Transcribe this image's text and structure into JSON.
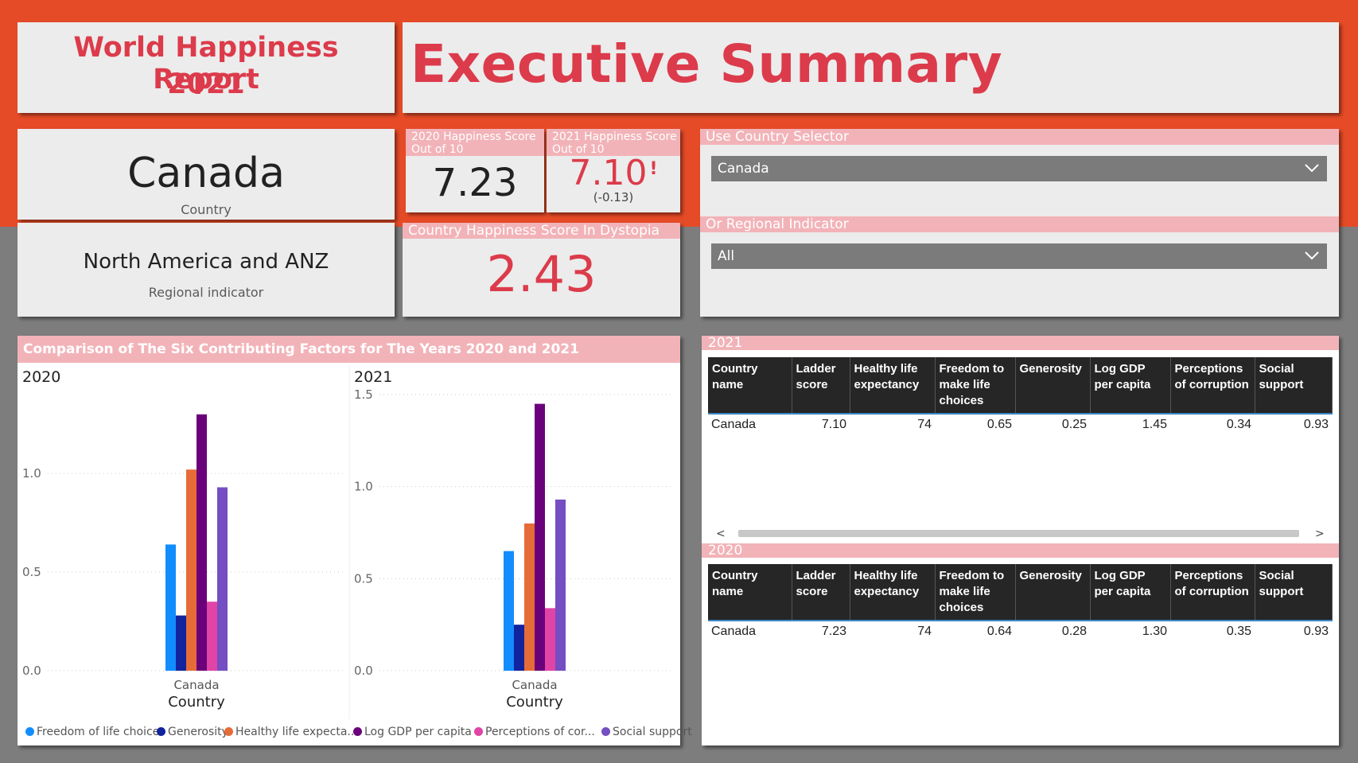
{
  "header": {
    "report_title_line1": "World Happiness Report",
    "report_title_line2": "2021",
    "page_title": "Executive Summary"
  },
  "country_card": {
    "value": "Canada",
    "label": "Country"
  },
  "region_card": {
    "value": "North America and ANZ",
    "label": "Regional indicator"
  },
  "kpi_2020": {
    "title": "2020 Happiness Score Out of 10",
    "value": "7.23"
  },
  "kpi_2021": {
    "title": "2021 Happiness Score Out of 10",
    "value": "7.10",
    "alert": "!",
    "delta": "(-0.13)"
  },
  "dystopia": {
    "title": "Country Happiness Score In Dystopia",
    "value": "2.43"
  },
  "selector": {
    "country_label": "Use Country Selector",
    "country_value": "Canada",
    "region_label": "Or Regional Indicator",
    "region_value": "All"
  },
  "colors": {
    "header_orange": "#e54b27",
    "title_red": "#dc3b4b",
    "pink_header": "#f2b3b8"
  },
  "chart": {
    "title": "Comparison of The Six Contributing Factors for The Years 2020 and 2021",
    "legend": [
      {
        "label": "Freedom of life choices",
        "color": "#118dff"
      },
      {
        "label": "Generosity",
        "color": "#12239e"
      },
      {
        "label": "Healthy life expecta...",
        "color": "#e66c37"
      },
      {
        "label": "Log GDP per capita",
        "color": "#6b007b"
      },
      {
        "label": "Perceptions of cor...",
        "color": "#e044a7"
      },
      {
        "label": "Social support",
        "color": "#744ec2"
      }
    ]
  },
  "chart_data": [
    {
      "type": "bar",
      "title": "2020",
      "xlabel": "Country",
      "categories": [
        "Canada"
      ],
      "ylim": [
        0,
        1.4
      ],
      "yticks": [
        "0.0",
        "0.5",
        "1.0"
      ],
      "grid": true,
      "legend_position": "bottom",
      "series": [
        {
          "name": "Freedom of life choices",
          "values": [
            0.64
          ]
        },
        {
          "name": "Generosity",
          "values": [
            0.28
          ]
        },
        {
          "name": "Healthy life expecta...",
          "values": [
            1.02
          ]
        },
        {
          "name": "Log GDP per capita",
          "values": [
            1.3
          ]
        },
        {
          "name": "Perceptions of cor...",
          "values": [
            0.35
          ]
        },
        {
          "name": "Social support",
          "values": [
            0.93
          ]
        }
      ]
    },
    {
      "type": "bar",
      "title": "2021",
      "xlabel": "Country",
      "categories": [
        "Canada"
      ],
      "ylim": [
        0,
        1.5
      ],
      "yticks": [
        "0.0",
        "0.5",
        "1.0",
        "1.5"
      ],
      "grid": true,
      "legend_position": "bottom",
      "series": [
        {
          "name": "Freedom of life choices",
          "values": [
            0.65
          ]
        },
        {
          "name": "Generosity",
          "values": [
            0.25
          ]
        },
        {
          "name": "Healthy life expecta...",
          "values": [
            0.8
          ]
        },
        {
          "name": "Log GDP per capita",
          "values": [
            1.45
          ]
        },
        {
          "name": "Perceptions of cor...",
          "values": [
            0.34
          ]
        },
        {
          "name": "Social support",
          "values": [
            0.93
          ]
        }
      ]
    }
  ],
  "tables": {
    "columns": [
      "Country name",
      "Ladder score",
      "Healthy life expectancy",
      "Freedom to make life choices",
      "Generosity",
      "Log GDP per capita",
      "Perceptions of corruption",
      "Social support"
    ],
    "t2021": {
      "title": "2021",
      "rows": [
        [
          "Canada",
          "7.10",
          "74",
          "0.65",
          "0.25",
          "1.45",
          "0.34",
          "0.93"
        ]
      ]
    },
    "t2020": {
      "title": "2020",
      "rows": [
        [
          "Canada",
          "7.23",
          "74",
          "0.64",
          "0.28",
          "1.30",
          "0.35",
          "0.93"
        ]
      ]
    }
  }
}
